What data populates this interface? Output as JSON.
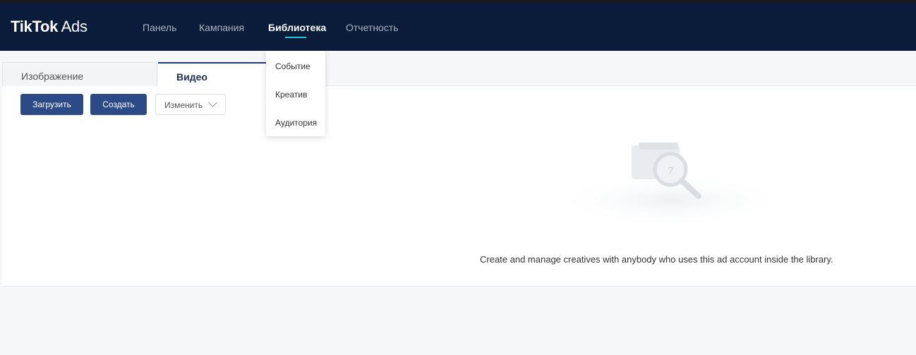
{
  "app": {
    "logo_brand": "TikTok",
    "logo_suffix": " Ads"
  },
  "nav": {
    "items": [
      {
        "label": "Панель"
      },
      {
        "label": "Кампания"
      },
      {
        "label": "Библиотека"
      },
      {
        "label": "Отчетность"
      }
    ],
    "active": "Библиотека",
    "accent_color": "#25c3d4"
  },
  "dropdown": {
    "items": [
      {
        "label": "Событие"
      },
      {
        "label": "Креатив"
      },
      {
        "label": "Аудитория"
      }
    ]
  },
  "tabs": {
    "image_label": "Изображение",
    "video_label": "Видео",
    "active": "Видео"
  },
  "toolbar": {
    "upload_label": "Загрузить",
    "create_label": "Создать",
    "edit_select_value": "Изменить"
  },
  "empty_state": {
    "message": "Create and manage creatives with anybody who uses this ad account inside the library.",
    "icon": "folder-search-icon"
  },
  "colors": {
    "header_bg": "#0b1c3a",
    "primary_button": "#2c4a86"
  }
}
